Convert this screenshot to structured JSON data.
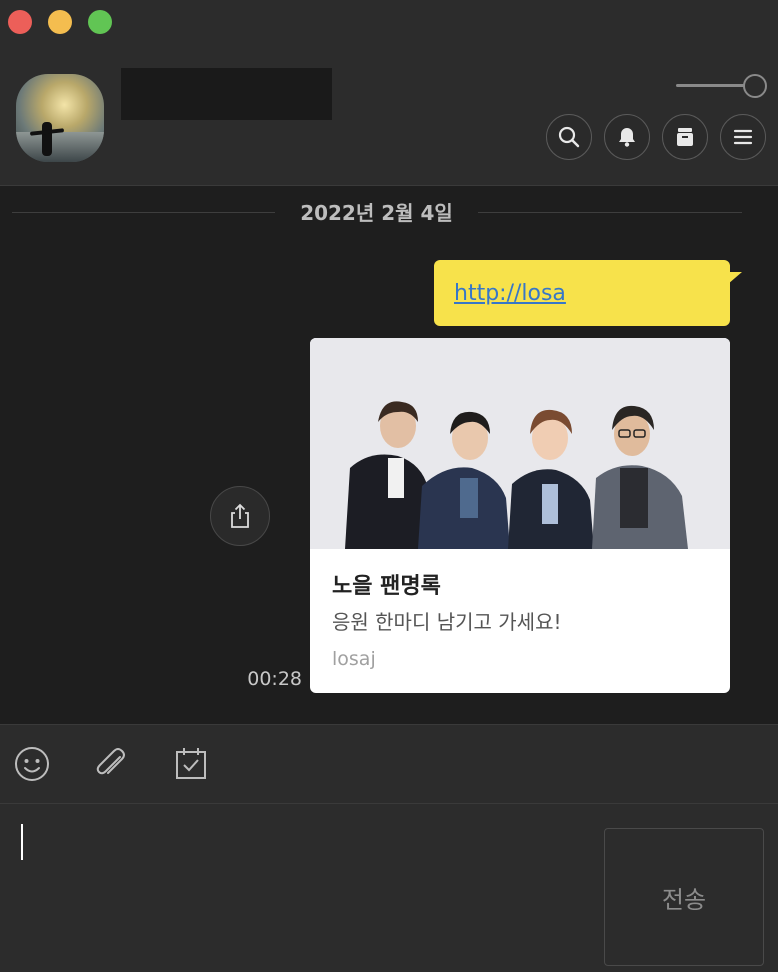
{
  "window": {
    "controls": [
      "close",
      "minimize",
      "zoom"
    ]
  },
  "header": {
    "chat_name": "",
    "avatar": "profile-photo",
    "buttons": [
      {
        "name": "search",
        "icon": "search-icon"
      },
      {
        "name": "notifications",
        "icon": "bell-icon"
      },
      {
        "name": "drawer",
        "icon": "drawer-icon"
      },
      {
        "name": "menu",
        "icon": "hamburger-menu-icon"
      }
    ]
  },
  "chat": {
    "date_divider": "2022년 2월 4일",
    "message": {
      "text": "http://losa",
      "time": "00:28"
    },
    "link_preview": {
      "title": "노을 팬명록",
      "description": "응원 한마디 남기고 가세요!",
      "domain": "losaj"
    }
  },
  "toolbar": {
    "tools": [
      {
        "name": "emoticon",
        "icon": "smiley-icon"
      },
      {
        "name": "attach-file",
        "icon": "paperclip-icon"
      },
      {
        "name": "schedule",
        "icon": "calendar-check-icon"
      }
    ]
  },
  "composer": {
    "input_value": "",
    "send_label": "전송"
  },
  "colors": {
    "bubble": "#f7e24b",
    "link": "#3777c8",
    "background": "#1e1e1e",
    "panel": "#2c2c2c"
  }
}
